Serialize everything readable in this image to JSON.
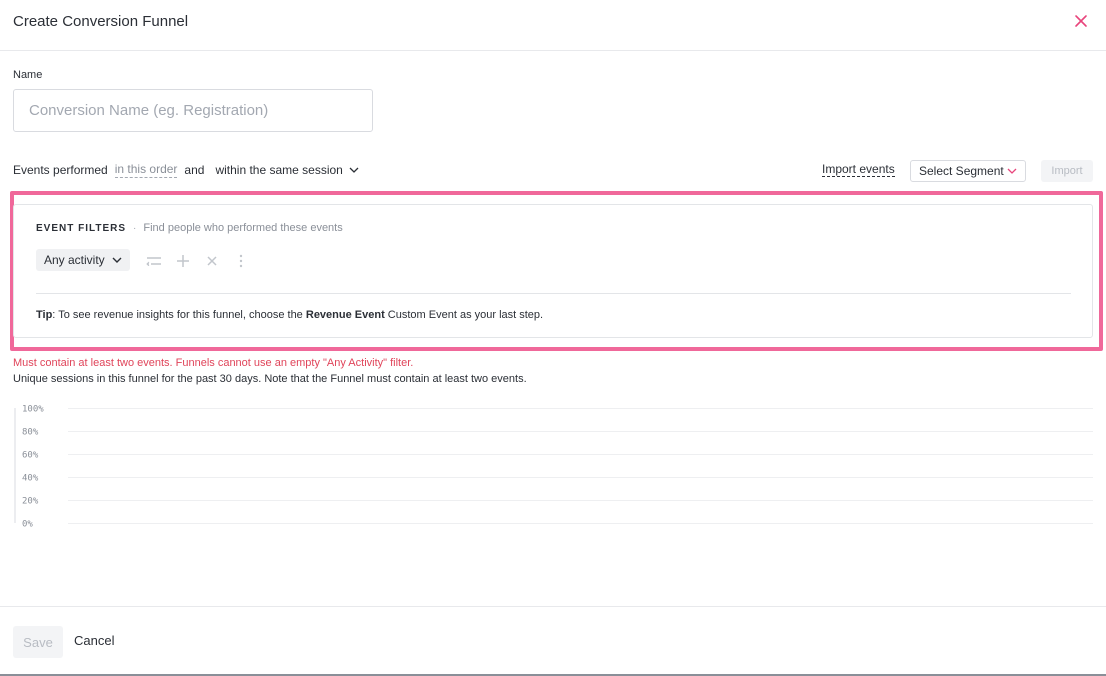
{
  "header": {
    "title": "Create Conversion Funnel",
    "close_icon": "close-icon"
  },
  "name_field": {
    "label": "Name",
    "placeholder": "Conversion Name (eg. Registration)",
    "value": ""
  },
  "events": {
    "prefix": "Events performed",
    "order_link": "in this order",
    "conjunction": "and",
    "session_option": "within the same session",
    "import_events_label": "Import events",
    "segment_placeholder": "Select Segment",
    "import_button": "Import"
  },
  "filters": {
    "heading": "EVENT FILTERS",
    "separator": "·",
    "description": "Find people who performed these events",
    "activity_label": "Any activity",
    "tools": [
      "filter-lines-icon",
      "plus-icon",
      "close-icon",
      "more-vertical-icon"
    ],
    "tip_label": "Tip",
    "tip_text_1": ": To see revenue insights for this funnel, choose the ",
    "tip_bold": "Revenue Event",
    "tip_text_2": " Custom Event as your last step."
  },
  "messages": {
    "error": "Must contain at least two events. Funnels cannot use an empty \"Any Activity\" filter.",
    "info": "Unique sessions in this funnel for the past 30 days. Note that the Funnel must contain at least two events."
  },
  "chart_data": {
    "type": "bar",
    "categories": [],
    "series": [],
    "y_ticks": [
      "100%",
      "80%",
      "60%",
      "40%",
      "20%",
      "0%"
    ],
    "ylim": [
      0,
      100
    ],
    "grid": true
  },
  "footer": {
    "save_label": "Save",
    "cancel_label": "Cancel"
  },
  "colors": {
    "accent": "#f0689a",
    "error": "#e0445a",
    "muted": "#8a8f98"
  }
}
